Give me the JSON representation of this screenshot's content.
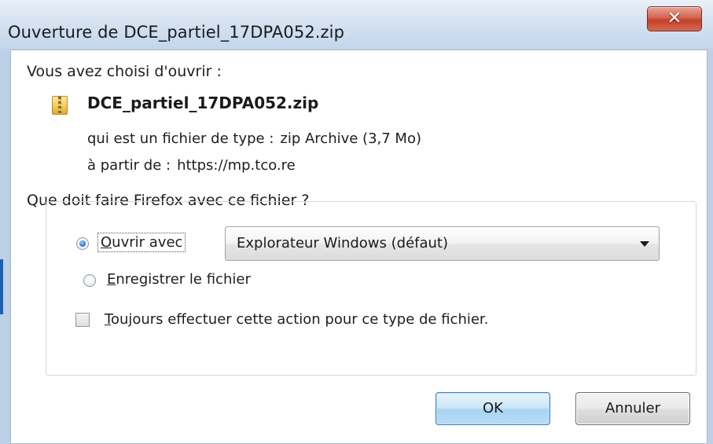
{
  "window": {
    "title": "Ouverture de DCE_partiel_17DPA052.zip",
    "close_label": "✕"
  },
  "file": {
    "intro": "Vous avez choisi d'ouvrir :",
    "icon": "zip-archive-icon",
    "name": "DCE_partiel_17DPA052.zip",
    "type_label": "qui est un fichier de type :",
    "type_value": "zip Archive (3,7 Mo)",
    "from_label": "à partir de :",
    "from_value": "https://mp.tco.re"
  },
  "question": "Que doit faire Firefox avec ce fichier ?",
  "options": {
    "open_with": {
      "mnemonic": "O",
      "rest": "uvrir avec",
      "checked": true
    },
    "open_with_app": {
      "selected": "Explorateur Windows (défaut)"
    },
    "save": {
      "mnemonic": "E",
      "rest": "nregistrer le fichier",
      "checked": false
    },
    "always": {
      "mnemonic": "T",
      "rest": "oujours effectuer cette action pour ce type de fichier.",
      "checked": false
    }
  },
  "buttons": {
    "ok": "OK",
    "cancel": "Annuler"
  },
  "colors": {
    "close_button": "#c4402a",
    "ok_button": "#a9d4f1",
    "radio_selected": "#2f7fd6"
  }
}
